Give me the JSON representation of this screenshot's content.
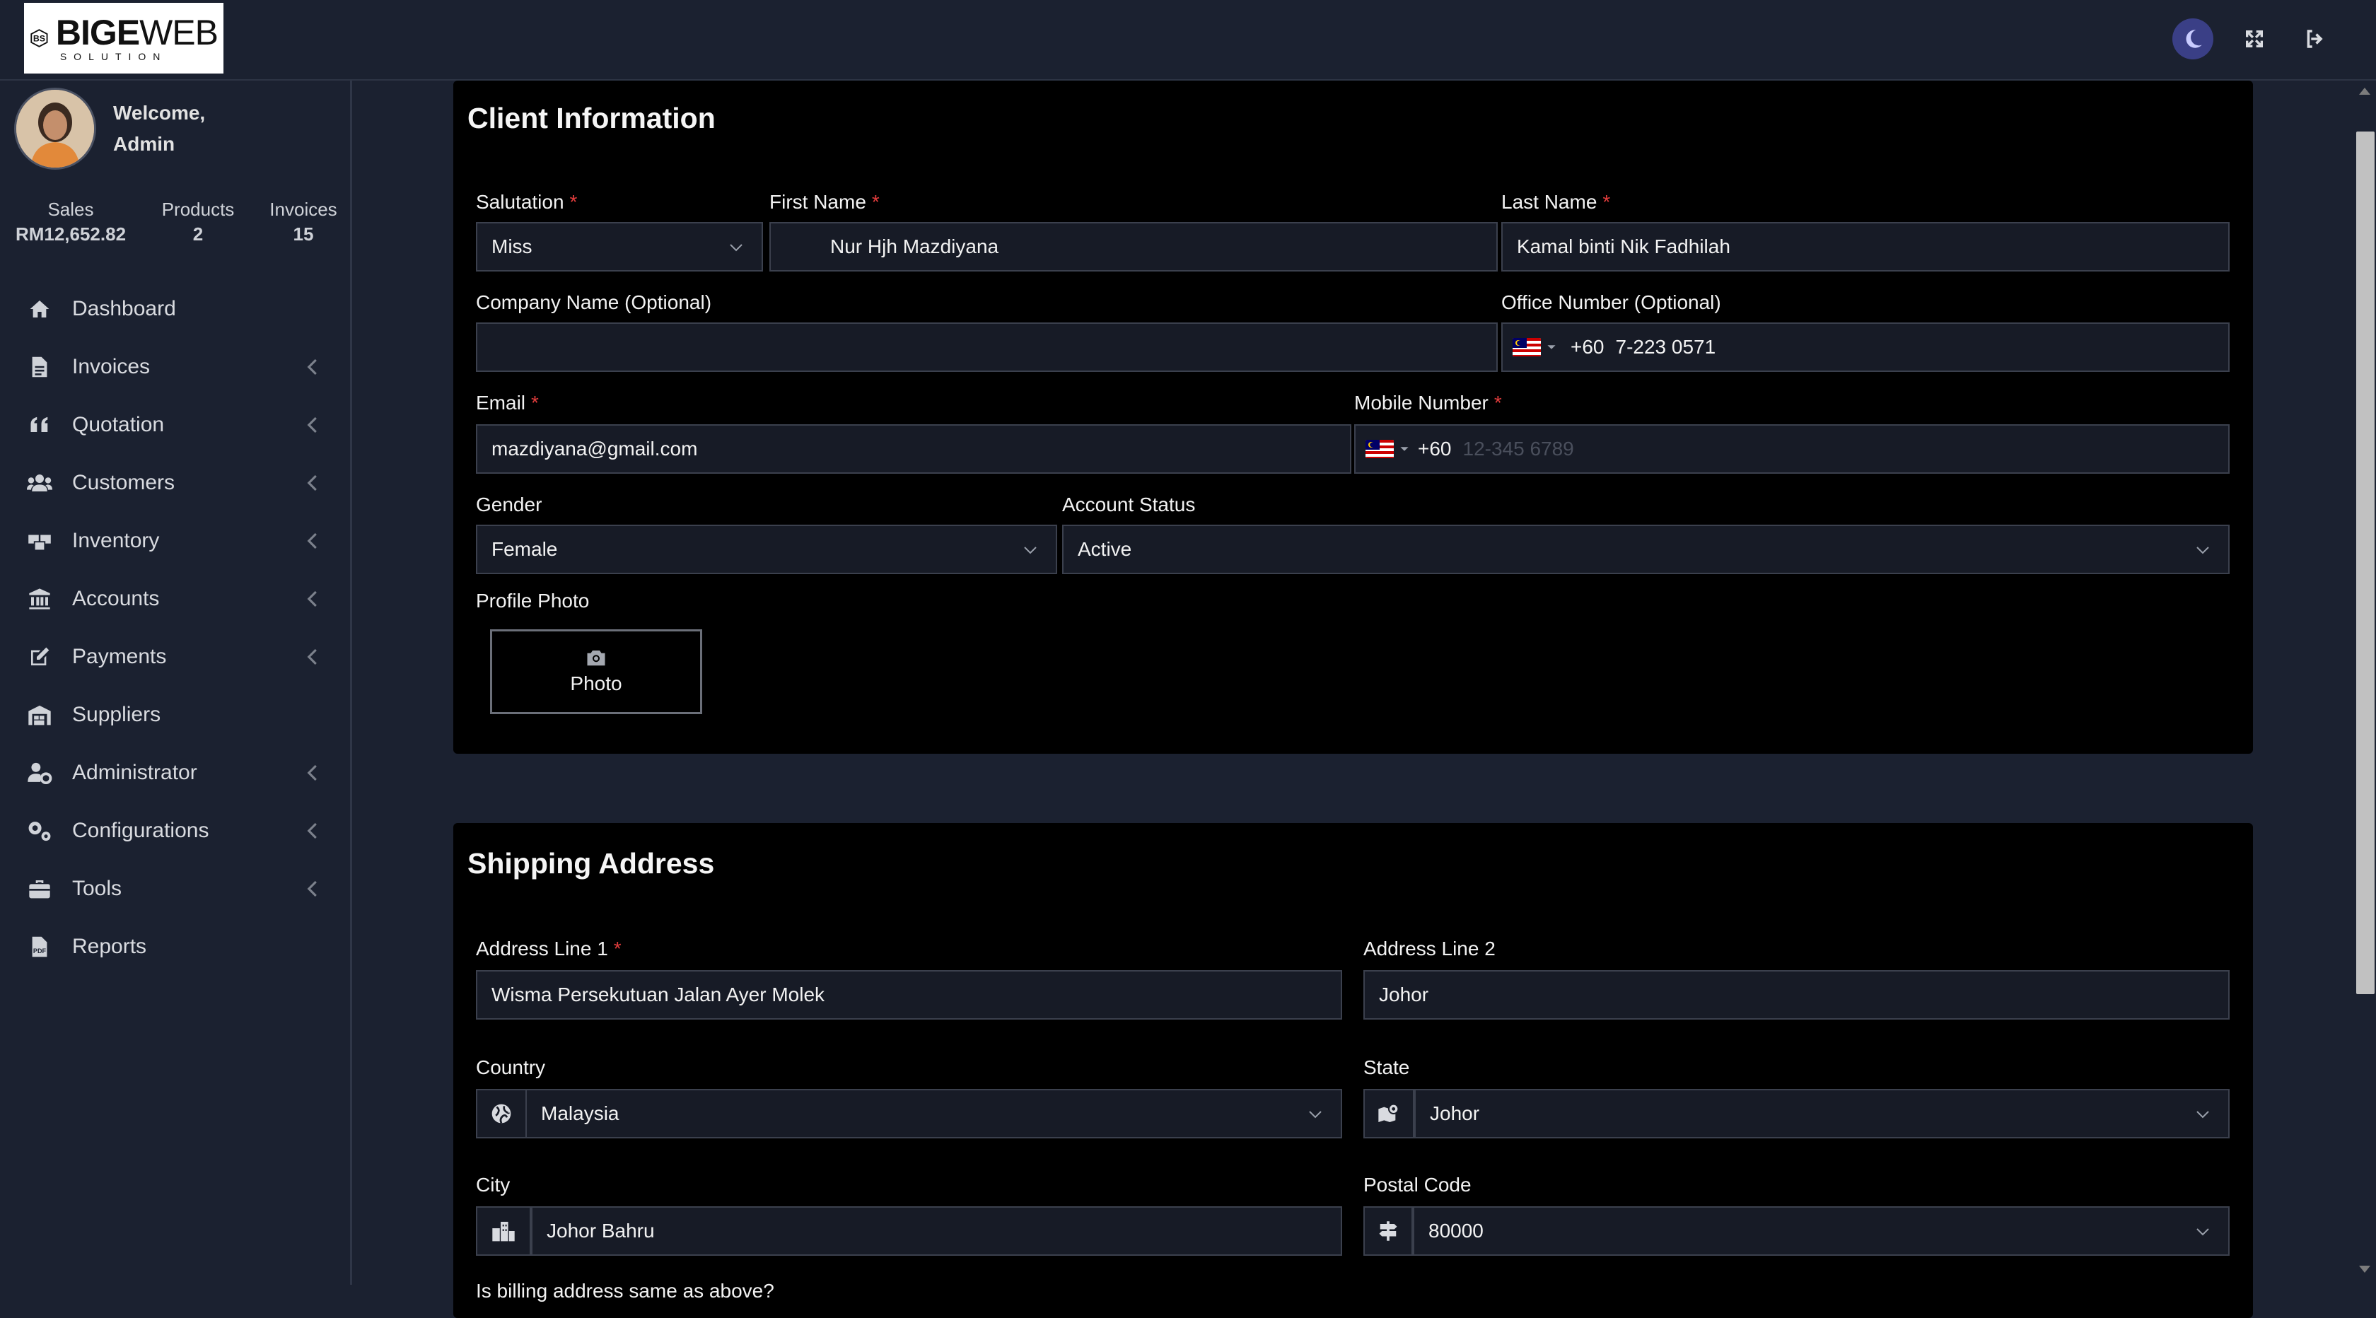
{
  "brand": {
    "name_bold": "BIGE",
    "name_thin": "WEB",
    "tagline": "SOLUTION"
  },
  "header": {
    "icons": [
      "moon-icon",
      "fullscreen-icon",
      "logout-icon"
    ],
    "accent_color": "#3a3f86"
  },
  "sidebar": {
    "welcome_line1": "Welcome,",
    "welcome_line2": "Admin",
    "stats": [
      {
        "label": "Sales",
        "value": "RM12,652.82"
      },
      {
        "label": "Products",
        "value": "2"
      },
      {
        "label": "Invoices",
        "value": "15"
      }
    ],
    "items": [
      {
        "label": "Dashboard",
        "icon": "home-icon",
        "expandable": false
      },
      {
        "label": "Invoices",
        "icon": "file-icon",
        "expandable": true
      },
      {
        "label": "Quotation",
        "icon": "quote-icon",
        "expandable": true
      },
      {
        "label": "Customers",
        "icon": "users-icon",
        "expandable": true
      },
      {
        "label": "Inventory",
        "icon": "boxes-icon",
        "expandable": true
      },
      {
        "label": "Accounts",
        "icon": "bank-icon",
        "expandable": true
      },
      {
        "label": "Payments",
        "icon": "edit-icon",
        "expandable": true
      },
      {
        "label": "Suppliers",
        "icon": "warehouse-icon",
        "expandable": false
      },
      {
        "label": "Administrator",
        "icon": "user-cog-icon",
        "expandable": true
      },
      {
        "label": "Configurations",
        "icon": "cogs-icon",
        "expandable": true
      },
      {
        "label": "Tools",
        "icon": "toolbox-icon",
        "expandable": true
      },
      {
        "label": "Reports",
        "icon": "file-pdf-icon",
        "expandable": false
      }
    ]
  },
  "client": {
    "title": "Client Information",
    "salutation": {
      "label": "Salutation",
      "value": "Miss"
    },
    "first_name": {
      "label": "First Name",
      "value": "Nur Hjh Mazdiyana"
    },
    "last_name": {
      "label": "Last Name",
      "value": "Kamal binti Nik Fadhilah"
    },
    "company": {
      "label": "Company Name (Optional)",
      "value": ""
    },
    "office": {
      "label": "Office Number (Optional)",
      "dial": "+60",
      "value": "7-223 0571"
    },
    "email": {
      "label": "Email",
      "value": "mazdiyana@gmail.com"
    },
    "mobile": {
      "label": "Mobile Number",
      "dial": "+60",
      "placeholder": "12-345 6789"
    },
    "gender": {
      "label": "Gender",
      "value": "Female"
    },
    "status": {
      "label": "Account Status",
      "value": "Active"
    },
    "photo": {
      "label": "Profile Photo",
      "button": "Photo"
    }
  },
  "shipping": {
    "title": "Shipping Address",
    "address1": {
      "label": "Address Line 1",
      "value": "Wisma Persekutuan Jalan Ayer Molek"
    },
    "address2": {
      "label": "Address Line 2",
      "value": "Johor"
    },
    "country": {
      "label": "Country",
      "value": "Malaysia"
    },
    "state": {
      "label": "State",
      "value": "Johor"
    },
    "city": {
      "label": "City",
      "value": "Johor Bahru"
    },
    "postal": {
      "label": "Postal Code",
      "value": "80000"
    },
    "billing_question": "Is billing address same as above?"
  }
}
